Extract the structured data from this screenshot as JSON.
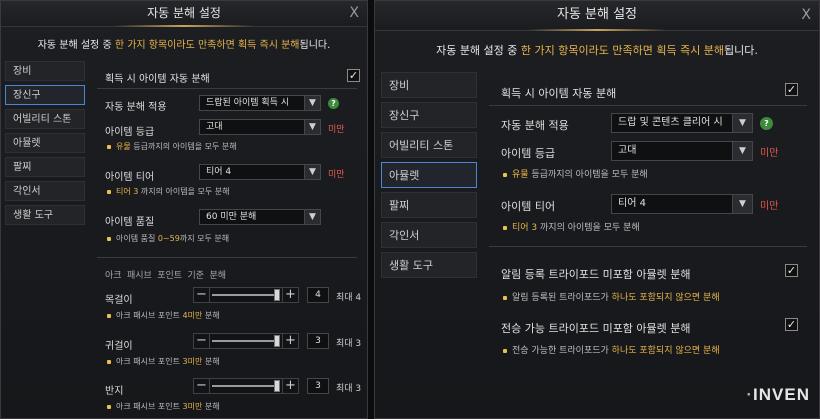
{
  "left": {
    "title": "자동 분해 설정",
    "close": "X",
    "notice": {
      "pre": "자동 분해 설정 중 ",
      "hl": "한 가지 항목이라도 만족하면 획득 즉시 분해",
      "post": "됩니다."
    },
    "sidebar": [
      "장비",
      "장신구",
      "어빌리티 스톤",
      "아뮬렛",
      "팔찌",
      "각인서",
      "생활 도구"
    ],
    "selected": 1,
    "auto_label": "획득 시 아이템 자동 분해",
    "apply": {
      "label": "자동 분해 적용",
      "value": "드랍된 아이템 획득 시",
      "help": "?"
    },
    "grade": {
      "label": "아이템 등급",
      "value": "고대",
      "suffix": "미만",
      "note_hl": "유물",
      "note": " 등급까지의 아이템을 모두 분해"
    },
    "tier": {
      "label": "아이템 티어",
      "value": "티어 4",
      "suffix": "미만",
      "note_hl": "티어 3",
      "note": " 까지의 아이템을 모두 분해"
    },
    "quality": {
      "label": "아이템 품질",
      "value": "60 미만 분해",
      "note_pre": "아이템 품질 ",
      "note_hl": "0~59",
      "note": "까지 모두 분해"
    },
    "section": "아크 패시브 포인트 기준 분해",
    "sliders": [
      {
        "label": "목걸이",
        "value": "4",
        "max": "최대 4",
        "level": 1.0,
        "note_pre": "아크 패시브 포인트 ",
        "note_hl": "4미만",
        "note": " 분해"
      },
      {
        "label": "귀걸이",
        "value": "3",
        "max": "최대 3",
        "level": 1.0,
        "note_pre": "아크 패시브 포인트 ",
        "note_hl": "3미만",
        "note": " 분해"
      },
      {
        "label": "반지",
        "value": "3",
        "max": "최대 3",
        "level": 1.0,
        "note_pre": "아크 패시브 포인트 ",
        "note_hl": "3미만",
        "note": " 분해"
      }
    ]
  },
  "right": {
    "title": "자동 분해 설정",
    "close": "X",
    "notice": {
      "pre": "자동 분해 설정 중 ",
      "hl": "한 가지 항목이라도 만족하면 획득 즉시 분해",
      "post": "됩니다."
    },
    "sidebar": [
      "장비",
      "장신구",
      "어빌리티 스톤",
      "아뮬렛",
      "팔찌",
      "각인서",
      "생활 도구"
    ],
    "selected": 3,
    "auto_label": "획득 시 아이템 자동 분해",
    "apply": {
      "label": "자동 분해 적용",
      "value": "드랍 및 콘텐츠 클리어 시",
      "help": "?"
    },
    "grade": {
      "label": "아이템 등급",
      "value": "고대",
      "suffix": "미만",
      "note_hl": "유물",
      "note": " 등급까지의 아이템을 모두 분해"
    },
    "tier": {
      "label": "아이템 티어",
      "value": "티어 4",
      "suffix": "미만",
      "note_hl": "티어 3",
      "note": " 까지의 아이템을 모두 분해"
    },
    "opt1": {
      "label": "알림 등록 트라이포드 미포함 아뮬렛 분해",
      "note_pre": "알림 등록된 트라이포드가 ",
      "note_hl": "하나도 포함되지 않으면 분해"
    },
    "opt2": {
      "label": "전승 가능 트라이포드 미포함 아뮬렛 분해",
      "note_pre": "전승 가능한 트라이포드가 ",
      "note_hl": "하나도 포함되지 않으면 분해"
    }
  },
  "watermark": {
    "pre": "",
    "mark": "·",
    "text": "INVEN"
  },
  "colors": {
    "highlight": "#e8b54a",
    "warning": "#e85a4a",
    "selected_border": "#4a86d4",
    "help": "#3d8a3a"
  }
}
